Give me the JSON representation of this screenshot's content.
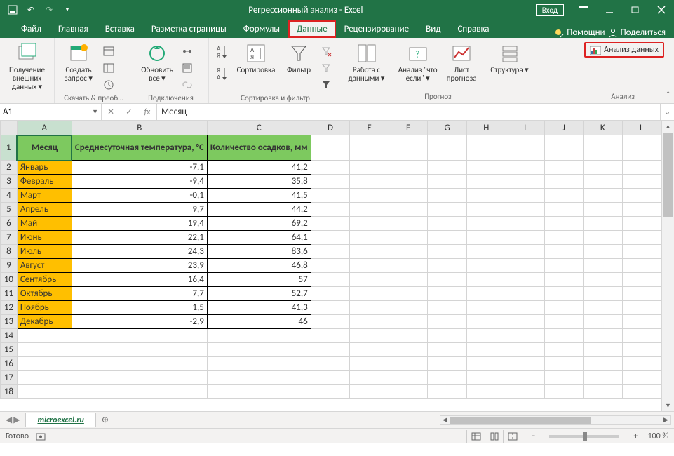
{
  "title": "Регрессионный анализ  -  Excel",
  "signin": "Вход",
  "tabs": [
    "Файл",
    "Главная",
    "Вставка",
    "Разметка страницы",
    "Формулы",
    "Данные",
    "Рецензирование",
    "Вид",
    "Справка"
  ],
  "active_tab": "Данные",
  "tell_me": "Помощни",
  "share": "Поделиться",
  "ribbon": {
    "g1": {
      "btn": "Получение\nвнешних данных ▾",
      "label": ""
    },
    "g2": {
      "btn": "Создать\nзапрос ▾",
      "label": "Скачать & преоб…"
    },
    "g3": {
      "btn": "Обновить\nвсе ▾",
      "label": "Подключения"
    },
    "g4": {
      "sort": "Сортировка",
      "filter": "Фильтр",
      "label": "Сортировка и фильтр"
    },
    "g5": {
      "btn": "Работа с\nданными ▾",
      "label": ""
    },
    "g6": {
      "b1": "Анализ \"что\nесли\" ▾",
      "b2": "Лист\nпрогноза",
      "label": "Прогноз"
    },
    "g7": {
      "btn": "Структура\n▾",
      "label": ""
    },
    "g8": {
      "btn": "Анализ данных",
      "label": "Анализ"
    }
  },
  "name_box": "A1",
  "formula": "Месяц",
  "columns": [
    "A",
    "B",
    "C",
    "D",
    "E",
    "F",
    "G",
    "H",
    "I",
    "J",
    "K",
    "L"
  ],
  "headers": {
    "A": "Месяц",
    "B": "Среднесуточная температура, °C",
    "C": "Количество осадков, мм"
  },
  "rows": [
    {
      "n": 2,
      "m": "Январь",
      "t": "-7,1",
      "p": "41,2"
    },
    {
      "n": 3,
      "m": "Февраль",
      "t": "-9,4",
      "p": "35,8"
    },
    {
      "n": 4,
      "m": "Март",
      "t": "-0,1",
      "p": "41,5"
    },
    {
      "n": 5,
      "m": "Апрель",
      "t": "9,7",
      "p": "44,2"
    },
    {
      "n": 6,
      "m": "Май",
      "t": "19,4",
      "p": "69,2"
    },
    {
      "n": 7,
      "m": "Июнь",
      "t": "22,1",
      "p": "64,1"
    },
    {
      "n": 8,
      "m": "Июль",
      "t": "24,3",
      "p": "83,6"
    },
    {
      "n": 9,
      "m": "Август",
      "t": "23,9",
      "p": "46,8"
    },
    {
      "n": 10,
      "m": "Сентябрь",
      "t": "16,4",
      "p": "57"
    },
    {
      "n": 11,
      "m": "Октябрь",
      "t": "7,7",
      "p": "52,7"
    },
    {
      "n": 12,
      "m": "Ноябрь",
      "t": "1,5",
      "p": "41,3"
    },
    {
      "n": 13,
      "m": "Декабрь",
      "t": "-2,9",
      "p": "46"
    }
  ],
  "empty_rows": [
    14,
    15,
    16,
    17,
    18
  ],
  "sheet": "microexcel.ru",
  "status": "Готово",
  "zoom": "100 %"
}
